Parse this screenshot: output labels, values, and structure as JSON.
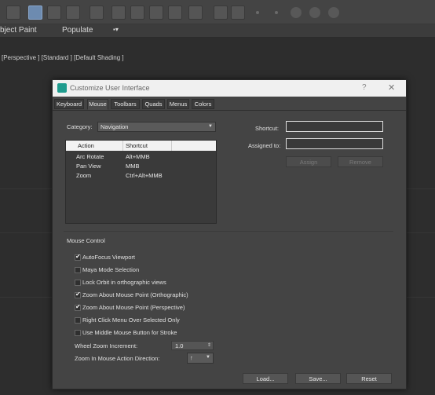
{
  "ribbon": {
    "items": [
      "bject Paint",
      "Populate"
    ]
  },
  "viewport": {
    "label": "[Perspective ] [Standard ] [Default Shading ]"
  },
  "dialog": {
    "title": "Customize User Interface",
    "help": "?",
    "close": "✕",
    "tabs": [
      "Keyboard",
      "Mouse",
      "Toolbars",
      "Quads",
      "Menus",
      "Colors"
    ],
    "active_tab": "Mouse",
    "category_label": "Category:",
    "category_value": "Navigation",
    "list": {
      "headers": [
        "Action",
        "Shortcut"
      ],
      "rows": [
        {
          "action": "Arc Rotate",
          "shortcut": "Alt+MMB"
        },
        {
          "action": "Pan View",
          "shortcut": "MMB"
        },
        {
          "action": "Zoom",
          "shortcut": "Ctrl+Alt+MMB"
        }
      ]
    },
    "shortcut_label": "Shortcut:",
    "assigned_label": "Assigned to:",
    "assign_button": "Assign",
    "remove_button": "Remove",
    "mouse_control_title": "Mouse Control",
    "options": [
      {
        "label": "AutoFocus Viewport",
        "checked": true
      },
      {
        "label": "Maya Mode Selection",
        "checked": false
      },
      {
        "label": "Lock Orbit in orthographic views",
        "checked": false
      },
      {
        "label": "Zoom About Mouse Point (Orthographic)",
        "checked": true
      },
      {
        "label": "Zoom About Mouse Point (Perspective)",
        "checked": true
      },
      {
        "label": "Right Click Menu Over Selected Only",
        "checked": false
      },
      {
        "label": "Use Middle Mouse Button for Stroke",
        "checked": false
      }
    ],
    "wheel_zoom_label": "Wheel Zoom Increment:",
    "wheel_zoom_value": "1.0",
    "zoom_direction_label": "Zoom In Mouse Action Direction:",
    "zoom_direction_value": "↑",
    "load_button": "Load...",
    "save_button": "Save...",
    "reset_button": "Reset"
  },
  "colors": {
    "accent": "#6d8bb0",
    "title_icon": "#1f9c8e"
  }
}
